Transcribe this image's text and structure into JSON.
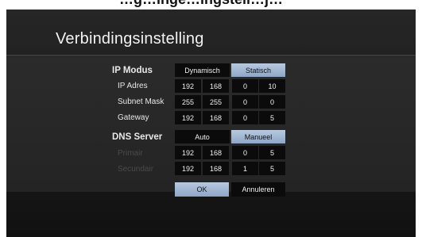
{
  "top_strip_text": "…g…inge…ingstell…j…",
  "title": "Verbindingsinstelling",
  "ip_mode": {
    "label": "IP Modus",
    "options": [
      "Dynamisch",
      "Statisch"
    ],
    "selected": "Statisch"
  },
  "ip_address": {
    "label": "IP Adres",
    "octets": [
      "192",
      "168",
      "0",
      "10"
    ]
  },
  "subnet_mask": {
    "label": "Subnet Mask",
    "octets": [
      "255",
      "255",
      "0",
      "0"
    ]
  },
  "gateway": {
    "label": "Gateway",
    "octets": [
      "192",
      "168",
      "0",
      "5"
    ]
  },
  "dns_server": {
    "label": "DNS Server",
    "options": [
      "Auto",
      "Manueel"
    ],
    "selected": "Manueel"
  },
  "primary_dns": {
    "label": "Primair",
    "octets": [
      "192",
      "168",
      "0",
      "5"
    ]
  },
  "secondary_dns": {
    "label": "Secundair",
    "octets": [
      "192",
      "168",
      "1",
      "5"
    ]
  },
  "ok_label": "OK",
  "cancel_label": "Annuleren",
  "colors": {
    "selected": "#9fb5d3",
    "field": "#0b0b0b",
    "panel": "#282828"
  }
}
